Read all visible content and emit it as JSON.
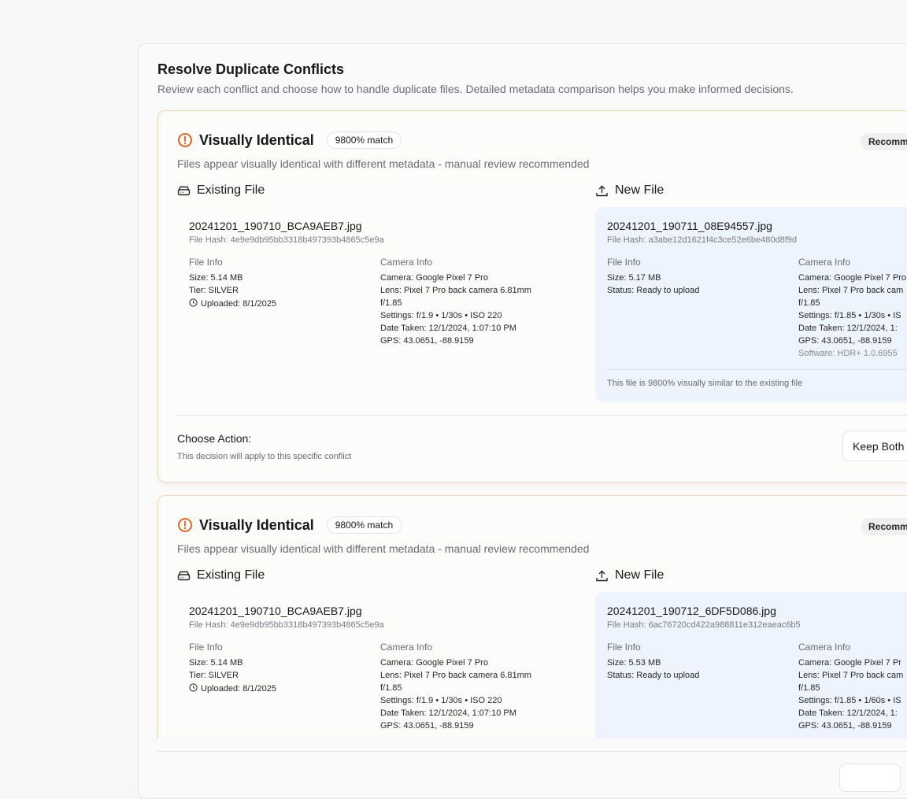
{
  "dialog": {
    "title": "Resolve Duplicate Conflicts",
    "description": "Review each conflict and choose how to handle duplicate files. Detailed metadata comparison helps you make informed decisions."
  },
  "labels": {
    "existing_file": "Existing File",
    "new_file": "New File",
    "file_info": "File Info",
    "camera_info": "Camera Info",
    "choose_action": "Choose Action:",
    "action_hint": "This decision will apply to this specific conflict",
    "keep_both": "Keep Both"
  },
  "conflicts": [
    {
      "title": "Visually Identical",
      "match_badge": "9800% match",
      "recommendation": "Recomm",
      "description": "Files appear visually identical with different metadata - manual review recommended",
      "existing": {
        "filename": "20241201_190710_BCA9AEB7.jpg",
        "hash": "File Hash: 4e9e9db95bb3318b497393b4865c5e9a",
        "size": "Size: 5.14 MB",
        "tier": "Tier: SILVER",
        "uploaded": "Uploaded: 8/1/2025",
        "camera": "Camera: Google Pixel 7 Pro",
        "lens_1": "Lens: Pixel 7 Pro back camera 6.81mm",
        "lens_2": "f/1.85",
        "settings": "Settings: f/1.9 • 1/30s • ISO 220",
        "date_taken": "Date Taken: 12/1/2024, 1:07:10 PM",
        "gps": "GPS: 43.0651, -88.9159"
      },
      "new": {
        "filename": "20241201_190711_08E94557.jpg",
        "hash": "File Hash: a3abe12d1621f4c3ce52e6be480d8f9d",
        "size": "Size: 5.17 MB",
        "status": "Status: Ready to upload",
        "camera": "Camera: Google Pixel 7 Pro",
        "lens_1": "Lens: Pixel 7 Pro back cam",
        "lens_2": "f/1.85",
        "settings": "Settings: f/1.85 • 1/30s • IS",
        "date_taken": "Date Taken: 12/1/2024, 1:",
        "gps": "GPS: 43.0651, -88.9159",
        "software": "Software: HDR+ 1.0.6955",
        "similarity": "This file is 9800% visually similar to the existing file"
      }
    },
    {
      "title": "Visually Identical",
      "match_badge": "9800% match",
      "recommendation": "Recomm",
      "description": "Files appear visually identical with different metadata - manual review recommended",
      "existing": {
        "filename": "20241201_190710_BCA9AEB7.jpg",
        "hash": "File Hash: 4e9e9db95bb3318b497393b4865c5e9a",
        "size": "Size: 5.14 MB",
        "tier": "Tier: SILVER",
        "uploaded": "Uploaded: 8/1/2025",
        "camera": "Camera: Google Pixel 7 Pro",
        "lens_1": "Lens: Pixel 7 Pro back camera 6.81mm",
        "lens_2": "f/1.85",
        "settings": "Settings: f/1.9 • 1/30s • ISO 220",
        "date_taken": "Date Taken: 12/1/2024, 1:07:10 PM",
        "gps": "GPS: 43.0651, -88.9159"
      },
      "new": {
        "filename": "20241201_190712_6DF5D086.jpg",
        "hash": "File Hash: 6ac76720cd422a988811e312eaeac6b5",
        "size": "Size: 5.53 MB",
        "status": "Status: Ready to upload",
        "camera": "Camera: Google Pixel 7 Pr",
        "lens_1": "Lens: Pixel 7 Pro back cam",
        "lens_2": "f/1.85",
        "settings": "Settings: f/1.85 • 1/60s • IS",
        "date_taken": "Date Taken: 12/1/2024, 1:",
        "gps": "GPS: 43.0651, -88.9159"
      }
    }
  ],
  "colors": {
    "warning": "#e8590c",
    "new_panel_bg": "#eef4fd",
    "card_border": "#f2d9b4"
  },
  "icons": {
    "conflict": "alert-circle-icon",
    "existing": "hard-drive-icon",
    "new": "upload-icon",
    "uploaded": "clock-icon"
  }
}
